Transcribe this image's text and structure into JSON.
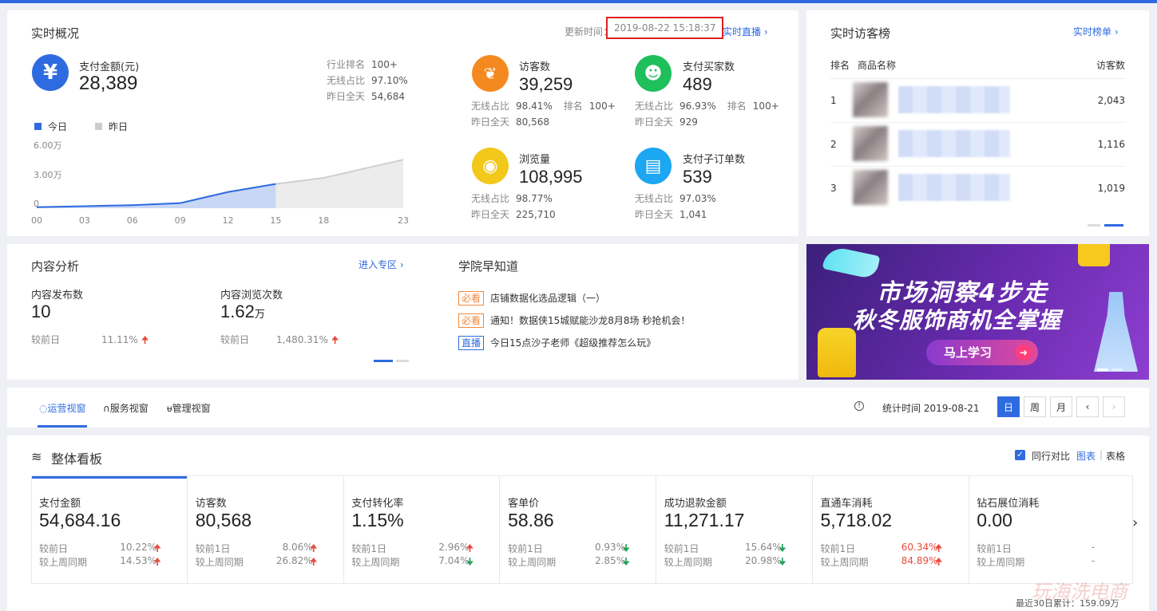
{
  "overview": {
    "title": "实时概况",
    "update_label": "更新时间：",
    "update_time": "2019-08-22 15:18:37",
    "live_link": "实时直播 ›",
    "payment": {
      "label": "支付金额(元)",
      "value": "28,389",
      "icon": "¥"
    },
    "payment_side": [
      {
        "k": "行业排名",
        "v": "100+"
      },
      {
        "k": "无线占比",
        "v": "97.10%"
      },
      {
        "k": "昨日全天",
        "v": "54,684"
      }
    ],
    "legend": {
      "today": "今日",
      "yesterday": "昨日"
    },
    "y_ticks": [
      "6.00万",
      "3.00万",
      "0"
    ],
    "x_ticks": [
      "00",
      "03",
      "06",
      "09",
      "12",
      "15",
      "18",
      "23"
    ],
    "visitors": {
      "label": "访客数",
      "value": "39,259",
      "l1": "无线占比",
      "v1": "98.41%",
      "rank_label": "排名",
      "rank": "100+",
      "l2": "昨日全天",
      "v2": "80,568"
    },
    "buyers": {
      "label": "支付买家数",
      "value": "489",
      "l1": "无线占比",
      "v1": "96.93%",
      "rank_label": "排名",
      "rank": "100+",
      "l2": "昨日全天",
      "v2": "929"
    },
    "pageviews": {
      "label": "浏览量",
      "value": "108,995",
      "l1": "无线占比",
      "v1": "98.77%",
      "l2": "昨日全天",
      "v2": "225,710"
    },
    "suborders": {
      "label": "支付子订单数",
      "value": "539",
      "l1": "无线占比",
      "v1": "97.03%",
      "l2": "昨日全天",
      "v2": "1,041"
    }
  },
  "chart_data": {
    "type": "area",
    "x": [
      0,
      3,
      6,
      9,
      12,
      15,
      18,
      23
    ],
    "ylim": [
      0,
      60000
    ],
    "series": [
      {
        "name": "今日",
        "x": [
          0,
          3,
          6,
          9,
          12,
          15
        ],
        "values": [
          1000,
          2000,
          3000,
          5000,
          16000,
          24000
        ]
      },
      {
        "name": "昨日",
        "x": [
          0,
          3,
          6,
          9,
          12,
          15,
          18,
          23
        ],
        "values": [
          1000,
          2000,
          3000,
          5000,
          16000,
          24000,
          30000,
          48000
        ]
      }
    ]
  },
  "visitors_rank": {
    "title": "实时访客榜",
    "link": "实时榜单 ›",
    "col_rank": "排名",
    "col_name": "商品名称",
    "col_visits": "访客数",
    "rows": [
      {
        "rank": "1",
        "visits": "2,043"
      },
      {
        "rank": "2",
        "visits": "1,116"
      },
      {
        "rank": "3",
        "visits": "1,019"
      }
    ]
  },
  "content": {
    "title": "内容分析",
    "link": "进入专区 ›",
    "posts": {
      "label": "内容发布数",
      "value": "10",
      "cmp": "较前日",
      "pct": "11.11%"
    },
    "views": {
      "label": "内容浏览次数",
      "value": "1.62",
      "unit": "万",
      "cmp": "较前日",
      "pct": "1,480.31%"
    }
  },
  "academy": {
    "title": "学院早知道",
    "items": [
      {
        "tag": "必看",
        "text": "店铺数据化选品逻辑（一）"
      },
      {
        "tag": "必看",
        "text": "通知！数据侠15城赋能沙龙8月8场 秒抢机会！"
      },
      {
        "tag": "直播",
        "text": "今日15点沙子老师《超级推荐怎么玩》"
      }
    ]
  },
  "banner": {
    "line1": "市场洞察4步走",
    "line2": "秋冬服饰商机全掌握",
    "cta": "马上学习"
  },
  "tabs": {
    "items": [
      "运营视窗",
      "服务视窗",
      "管理视窗"
    ],
    "stat_label": "统计时间 2019-08-21",
    "day": "日",
    "week": "周",
    "month": "月"
  },
  "board": {
    "title": "整体看板",
    "compare_label": "同行对比",
    "view_chart": "图表",
    "view_table": "表格",
    "sep": "|",
    "footer": "最近30日累计：159.09万",
    "watermark": "玩海洗电商",
    "metrics": [
      {
        "label": "支付金额",
        "value": "54,684.16",
        "d1": "较前日",
        "p1": "10.22%",
        "w1": "较上周同期",
        "p2": "14.53%"
      },
      {
        "label": "访客数",
        "value": "80,568",
        "d1": "较前1日",
        "p1": "8.06%",
        "w1": "较上周同期",
        "p2": "26.82%"
      },
      {
        "label": "支付转化率",
        "value": "1.15%",
        "d1": "较前1日",
        "p1": "2.96%",
        "w1": "较上周同期",
        "p2": "7.04%"
      },
      {
        "label": "客单价",
        "value": "58.86",
        "d1": "较前1日",
        "p1": "0.93%",
        "w1": "较上周同期",
        "p2": "2.85%"
      },
      {
        "label": "成功退款金额",
        "value": "11,271.17",
        "d1": "较前1日",
        "p1": "15.64%",
        "w1": "较上周同期",
        "p2": "20.98%"
      },
      {
        "label": "直通车消耗",
        "value": "5,718.02",
        "d1": "较前1日",
        "p1": "60.34%",
        "w1": "较上周同期",
        "p2": "84.89%"
      },
      {
        "label": "钻石展位消耗",
        "value": "0.00",
        "d1": "较前1日",
        "p1": "-",
        "w1": "较上周同期",
        "p2": "-"
      }
    ]
  },
  "colors": {
    "accent": "#2f6be0",
    "up": "#e84c3d",
    "down": "#23a45a",
    "orange": "#f48a1f",
    "green": "#1fbf5b",
    "yellow": "#f2c81b",
    "cyan": "#1da6f2"
  }
}
